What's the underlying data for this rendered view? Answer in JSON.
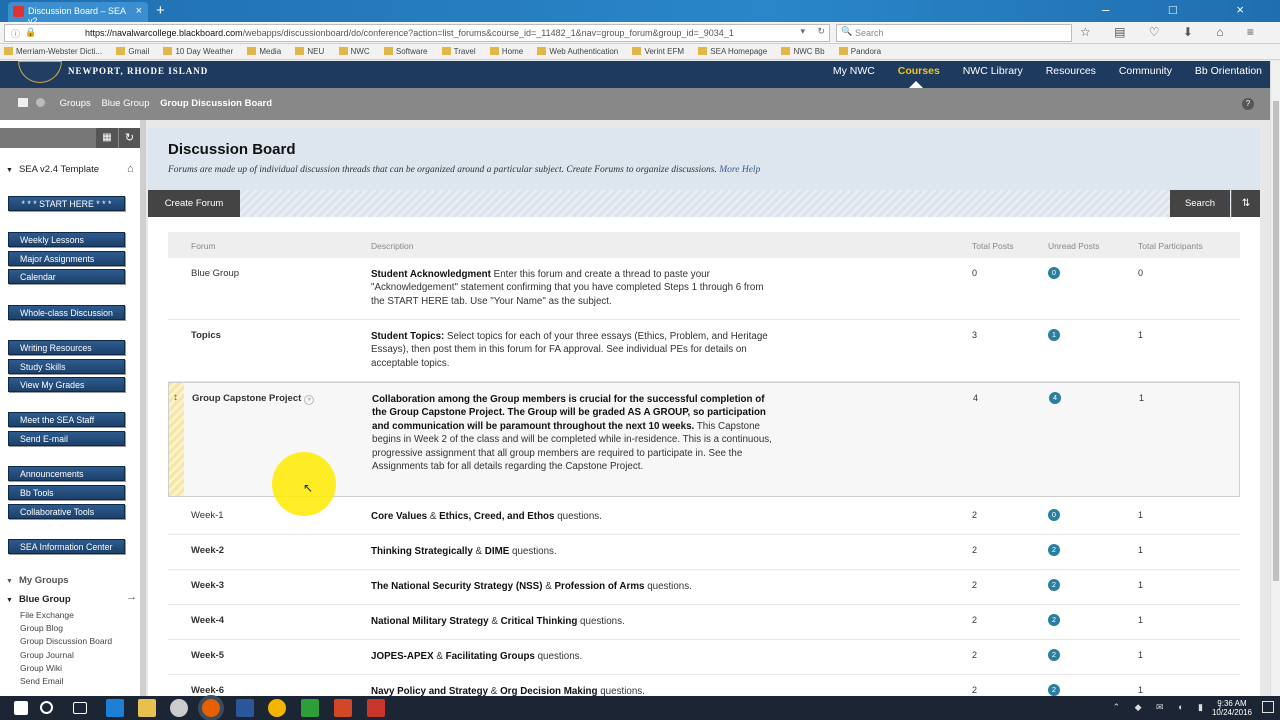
{
  "browser": {
    "tab_title": "Discussion Board – SEA v2...",
    "url_host": "https://navalwarcollege.blackboard.com",
    "url_path": "/webapps/discussionboard/do/conference?action=list_forums&course_id=_11482_1&nav=group_forum&group_id=_9034_1",
    "search_placeholder": "Search",
    "bookmarks": [
      "Merriam-Webster Dicti...",
      "Gmail",
      "10 Day Weather",
      "Media",
      "NEU",
      "NWC",
      "Software",
      "Travel",
      "Home",
      "Web Authentication",
      "Verint EFM",
      "SEA Homepage",
      "NWC Bb",
      "Pandora"
    ]
  },
  "site": {
    "logo_text": "NEWPORT, RHODE ISLAND",
    "nav": [
      "My NWC",
      "Courses",
      "NWC Library",
      "Resources",
      "Community",
      "Bb Orientation"
    ],
    "active_nav": "Courses",
    "breadcrumb": [
      "Groups",
      "Blue Group",
      "Group Discussion Board"
    ]
  },
  "menu": {
    "course_title": "SEA v2.4 Template",
    "buttons": [
      "* * * START HERE * * *",
      "Weekly Lessons",
      "Major Assignments",
      "Calendar",
      "Whole-class Discussion",
      "Writing Resources",
      "Study Skills",
      "View My Grades",
      "Meet the SEA Staff",
      "Send E-mail",
      "Announcements",
      "Bb Tools",
      "Collaborative Tools",
      "SEA Information Center"
    ],
    "my_groups": "My Groups",
    "group_name": "Blue Group",
    "group_links": [
      "File Exchange",
      "Group Blog",
      "Group Discussion Board",
      "Group Journal",
      "Group Wiki",
      "Send Email"
    ]
  },
  "page": {
    "title": "Discussion Board",
    "subtitle": "Forums are made up of individual discussion threads that can be organized around a particular subject. Create Forums to organize discussions.",
    "more_help": "More Help",
    "create_forum": "Create Forum",
    "search_btn": "Search"
  },
  "table": {
    "headers": [
      "Forum",
      "Description",
      "Total Posts",
      "Unread Posts",
      "Total Participants"
    ],
    "rows": [
      {
        "forum": "Blue Group",
        "desc_bold": "Student Acknowledgment",
        "desc_rest": " Enter this forum and create a thread to paste your \"Acknowledgement\" statement confirming that you have completed Steps 1 through 6 from the START HERE tab.  Use \"Your Name\" as the subject.",
        "total": "0",
        "unread": "0",
        "participants": "0"
      },
      {
        "forum": "Topics",
        "desc_bold": "Student Topics:",
        "desc_rest": " Select topics for each of your three essays (Ethics, Problem, and Heritage Essays), then post them in this forum for FA approval.  See individual PEs for details on acceptable topics.",
        "total": "3",
        "unread": "1",
        "participants": "1"
      },
      {
        "forum": "Group Capstone Project",
        "desc_bold": "Collaboration among the Group members is crucial for the successful completion of the Group Capstone Project.  The Group will be graded AS A GROUP, so participation and communication will be paramount throughout the next 10 weeks.",
        "desc_rest": "  This Capstone begins in Week 2 of the class and will be completed while in-residence.  This is a continuous, progressive assignment that all group members are required to participate in.  See the Assignments tab for all details regarding the Capstone Project.",
        "total": "4",
        "unread": "4",
        "participants": "1"
      },
      {
        "forum": "Week-1",
        "desc_html_parts": [
          "Core Values",
          " & ",
          "Ethics, Creed, and Ethos",
          " questions."
        ],
        "total": "2",
        "unread": "0",
        "participants": "1"
      },
      {
        "forum": "Week-2",
        "desc_html_parts": [
          "Thinking Strategically",
          " & ",
          "DIME",
          " questions."
        ],
        "total": "2",
        "unread": "2",
        "participants": "1"
      },
      {
        "forum": "Week-3",
        "desc_html_parts": [
          "The National Security Strategy (NSS)",
          " & ",
          "Profession of Arms",
          " questions."
        ],
        "total": "2",
        "unread": "2",
        "participants": "1"
      },
      {
        "forum": "Week-4",
        "desc_html_parts": [
          "National Military Strategy",
          " & ",
          "Critical Thinking",
          " questions."
        ],
        "total": "2",
        "unread": "2",
        "participants": "1"
      },
      {
        "forum": "Week-5",
        "desc_html_parts": [
          "JOPES-APEX",
          " & ",
          "Facilitating Groups",
          " questions."
        ],
        "total": "2",
        "unread": "2",
        "participants": "1"
      },
      {
        "forum": "Week-6",
        "desc_html_parts": [
          "Navy Policy and Strategy",
          " & ",
          "Org Decision Making",
          " questions."
        ],
        "total": "2",
        "unread": "2",
        "participants": "1"
      }
    ]
  },
  "taskbar": {
    "time": "9:36 AM",
    "date": "10/24/2016"
  },
  "colors": {
    "header_navy": "#1e3a5f",
    "active_nav": "#f0c419",
    "unread_badge": "#2a7fa0",
    "menu_button": "#2d5b8e"
  }
}
